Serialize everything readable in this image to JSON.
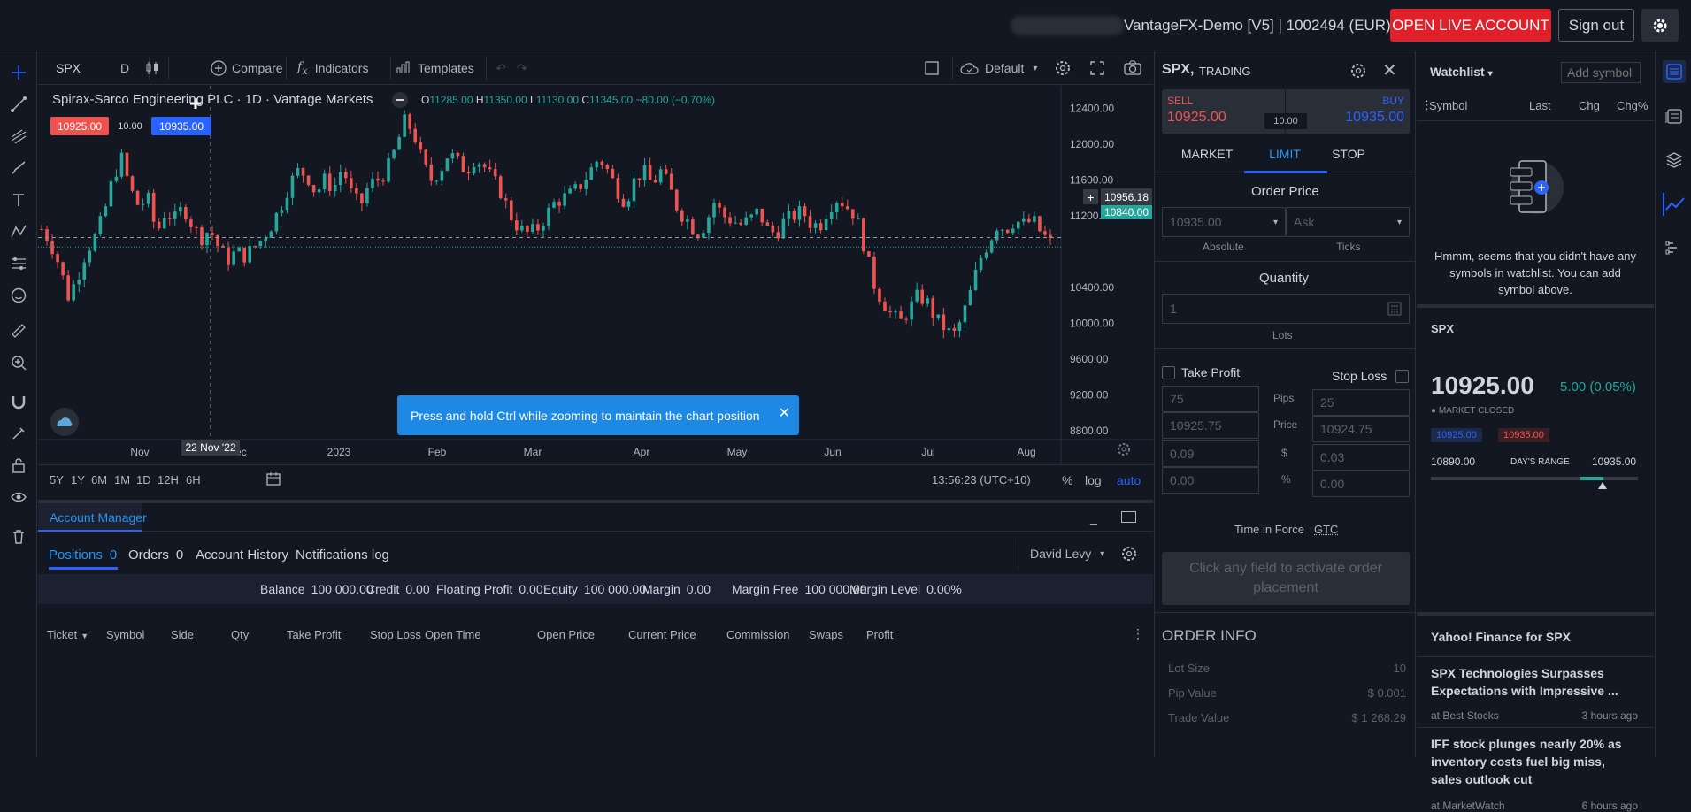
{
  "topbar": {
    "account_info": "VantageFX-Demo [V5] | 1002494 (EUR)",
    "open_live_label": "OPEN LIVE ACCOUNT",
    "sign_out_label": "Sign out"
  },
  "toolbar": {
    "symbol": "SPX",
    "interval": "D",
    "compare_label": "Compare",
    "indicators_label": "Indicators",
    "templates_label": "Templates",
    "layout_label": "Default"
  },
  "chart": {
    "title": "Spirax-Sarco Engineering PLC · 1D · Vantage Markets",
    "ohlc": {
      "o_label": "O",
      "o": "11285.00",
      "h_label": "H",
      "h": "11350.00",
      "l_label": "L",
      "l": "11130.00",
      "c_label": "C",
      "c": "11345.00",
      "change": "−80.00 (−0.70%)"
    },
    "sell_price": "10925.00",
    "spread": "10.00",
    "buy_price": "10935.00",
    "crosshair_price": "10956.18",
    "last_price_label": "10840.00",
    "crosshair_date": "22 Nov '22",
    "toast": "Press and hold Ctrl while zooming to maintain the chart position",
    "timezone": "13:56:23 (UTC+10)",
    "pct_label": "%",
    "log_label": "log",
    "auto_label": "auto",
    "ranges": [
      "5Y",
      "1Y",
      "6M",
      "1M",
      "1D",
      "12H",
      "6H"
    ]
  },
  "chart_data": {
    "type": "candlestick",
    "x_ticks": [
      "Nov",
      "Dec",
      "2023",
      "Feb",
      "Mar",
      "Apr",
      "May",
      "Jun",
      "Jul",
      "Aug"
    ],
    "y_ticks": [
      "12400.00",
      "12000.00",
      "11600.00",
      "11200.00",
      "10400.00",
      "10000.00",
      "9600.00",
      "9200.00",
      "8800.00"
    ],
    "ylim": [
      8700,
      12650
    ],
    "close_path": [
      11050,
      10900,
      10650,
      10300,
      10500,
      10800,
      10950,
      11200,
      11600,
      11850,
      11500,
      11300,
      11400,
      11000,
      11250,
      11150,
      11300,
      11100,
      10950,
      11050,
      10850,
      10700,
      10800,
      10750,
      10850,
      10950,
      11100,
      11300,
      11550,
      11700,
      11650,
      11450,
      11600,
      11500,
      11750,
      11450,
      11300,
      11550,
      11600,
      11700,
      11950,
      12250,
      12150,
      11800,
      11600,
      11700,
      11900,
      11800,
      11700,
      11850,
      11750,
      11600,
      11450,
      11200,
      11050,
      11000,
      11050,
      11200,
      11350,
      11400,
      11450,
      11550,
      11700,
      11850,
      11700,
      11500,
      11350,
      11600,
      11700,
      11550,
      11700,
      11500,
      11250,
      11150,
      11000,
      11100,
      11350,
      11200,
      11150,
      11100,
      11150,
      11250,
      11050,
      11000,
      11150,
      11200,
      11250,
      11100,
      11100,
      11300,
      11400,
      11300,
      11200,
      10850,
      10450,
      10250,
      10100,
      10000,
      10150,
      10300,
      10250,
      10050,
      9950,
      9850,
      10050,
      10350,
      10700,
      10900,
      11100,
      11050,
      11150,
      11100,
      11150,
      11000,
      10900
    ]
  },
  "account": {
    "title": "Account Manager",
    "tabs": [
      {
        "label": "Positions",
        "count": "0"
      },
      {
        "label": "Orders",
        "count": "0"
      },
      {
        "label": "Account History"
      },
      {
        "label": "Notifications log"
      }
    ],
    "user": "David Levy",
    "summary": [
      {
        "label": "Balance",
        "value": "100 000.00"
      },
      {
        "label": "Credit",
        "value": "0.00"
      },
      {
        "label": "Floating Profit",
        "value": "0.00"
      },
      {
        "label": "Equity",
        "value": "100 000.00"
      },
      {
        "label": "Margin",
        "value": "0.00"
      },
      {
        "label": "Margin Free",
        "value": "100 000.00"
      },
      {
        "label": "Margin Level",
        "value": "0.00%"
      }
    ],
    "columns": [
      "Ticket",
      "Symbol",
      "Side",
      "Qty",
      "Take Profit",
      "Stop Loss",
      "Open Time",
      "Open Price",
      "Current Price",
      "Commission",
      "Swaps",
      "Profit"
    ]
  },
  "trade": {
    "symbol": "SPX,",
    "mode": "TRADING",
    "sell_label": "SELL",
    "sell_price": "10925.00",
    "buy_label": "BUY",
    "buy_price": "10935.00",
    "spread": "10.00",
    "tabs": [
      "MARKET",
      "LIMIT",
      "STOP"
    ],
    "order_price_label": "Order Price",
    "price_value": "10935.00",
    "ask_value": "Ask",
    "absolute_label": "Absolute",
    "ticks_label": "Ticks",
    "quantity_label": "Quantity",
    "quantity_value": "1",
    "lots_label": "Lots",
    "take_profit_label": "Take Profit",
    "stop_loss_label": "Stop Loss",
    "row_labels": [
      "Pips",
      "Price",
      "$",
      "%"
    ],
    "tp_values": [
      "75",
      "10925.75",
      "0.09",
      "0.00"
    ],
    "sl_values": [
      "25",
      "10924.75",
      "0.03",
      "0.00"
    ],
    "tif_label": "Time in Force",
    "tif_value": "GTC",
    "submit_label": "Click any field to activate order placement",
    "order_info_title": "ORDER INFO",
    "order_info": [
      {
        "label": "Lot Size",
        "value": "10"
      },
      {
        "label": "Pip Value",
        "value": "$ 0.001"
      },
      {
        "label": "Trade Value",
        "value": "$ 1 268.29"
      }
    ]
  },
  "watchlist": {
    "title": "Watchlist",
    "add_placeholder": "Add symbol",
    "columns": [
      "Symbol",
      "Last",
      "Chg",
      "Chg%"
    ],
    "empty_message": "Hmmm, seems that you didn't have any symbols in watchlist. You can add symbol above.",
    "symbol": "SPX",
    "price": "10925.00",
    "change": "5.00 (0.05%)",
    "market_status": "MARKET CLOSED",
    "bid": "10925.00",
    "ask": "10935.00",
    "range_low": "10890.00",
    "range_label": "DAY'S RANGE",
    "range_high": "10935.00",
    "range_fraction": 0.78,
    "news_title": "Yahoo! Finance for SPX",
    "news": [
      {
        "headline": "SPX Technologies Surpasses Expectations with Impressive ...",
        "source": "at Best Stocks",
        "time": "3 hours ago"
      },
      {
        "headline": "IFF stock plunges nearly 20% as inventory costs fuel big miss, sales outlook cut",
        "source": "at MarketWatch",
        "time": "6 hours ago"
      }
    ]
  }
}
